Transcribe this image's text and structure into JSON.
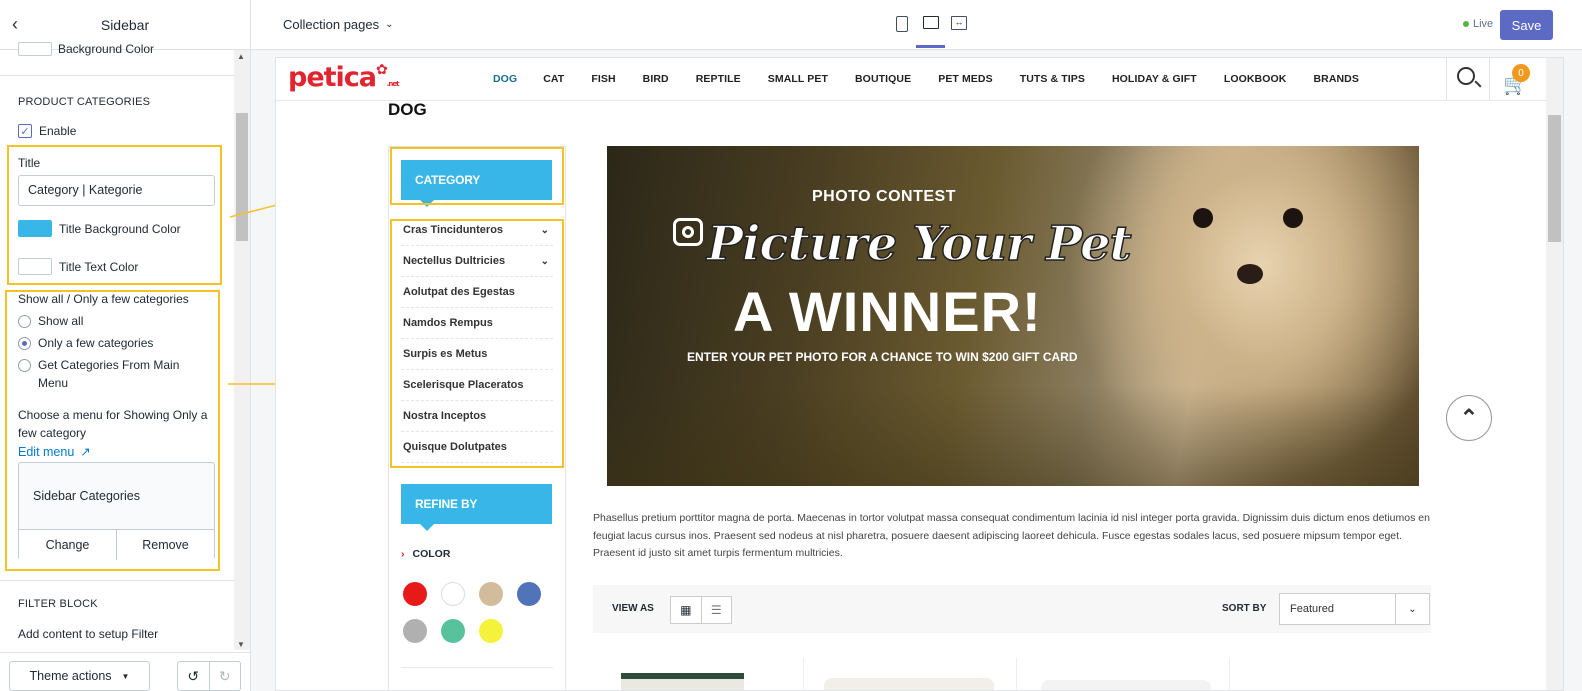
{
  "sidebar_panel": {
    "title": "Sidebar",
    "bg_color_label": "Background Color",
    "product_categories": {
      "heading": "PRODUCT CATEGORIES",
      "enable_label": "Enable",
      "enable_checked": true,
      "title_label": "Title",
      "title_value": "Category | Kategorie",
      "title_bg_label": "Title Background Color",
      "title_bg_color": "#38b6e8",
      "title_text_label": "Title Text Color",
      "title_text_color": "#ffffff",
      "show_label": "Show all / Only a few categories",
      "options": [
        "Show all",
        "Only a few categories",
        "Get Categories From Main Menu"
      ],
      "selected_option": "Only a few categories",
      "menu_label": "Choose a menu for Showing Only a few category",
      "edit_menu": "Edit menu",
      "menu_name": "Sidebar Categories",
      "change": "Change",
      "remove": "Remove"
    },
    "filter_block": {
      "heading": "FILTER BLOCK",
      "text": "Add content to setup Filter"
    },
    "theme_actions": "Theme actions"
  },
  "topbar": {
    "page_selector": "Collection pages",
    "live_label": "Live",
    "live_color": "#50b83c",
    "save": "Save",
    "accent": "#5c6ac4"
  },
  "store": {
    "logo": "petica",
    "logo_suffix": ".net",
    "nav": [
      "DOG",
      "CAT",
      "FISH",
      "BIRD",
      "REPTILE",
      "SMALL PET",
      "BOUTIQUE",
      "PET MEDS",
      "TUTS & TIPS",
      "HOLIDAY & GIFT",
      "LOOKBOOK",
      "BRANDS"
    ],
    "nav_active": "DOG",
    "cart_count": "0",
    "page_title": "DOG",
    "category_title": "CATEGORY",
    "categories": [
      "Cras Tincidunteros",
      "Nectellus Dultricies",
      "Aolutpat des Egestas",
      "Namdos Rempus",
      "Surpis es Metus",
      "Scelerisque Placeratos",
      "Nostra Inceptos",
      "Quisque Dolutpates"
    ],
    "categories_with_chevron": [
      "Cras Tincidunteros",
      "Nectellus Dultricies"
    ],
    "refine_title": "REFINE BY",
    "color_filter": "COLOR",
    "swatches": [
      "#e81919",
      "#ffffff",
      "#d2bc9c",
      "#5173b8",
      "#b0b0b0",
      "#57c29c",
      "#f5f23b"
    ],
    "banner": {
      "contest": "PHOTO CONTEST",
      "script": "Picture Your Pet",
      "winner": "A WINNER!",
      "subline": "ENTER YOUR PET PHOTO FOR A CHANCE TO WIN $200 GIFT CARD"
    },
    "description": "Phasellus pretium porttitor magna de porta. Maecenas in tortor volutpat massa consequat condimentum lacinia id nisl integer porta gravida. Dignissim duis dictum enos detiumos en feugiat lacus cursus inos. Praesent sed nodeus at nisl pharetra, posuere daesent adipiscing laoreet dehicula. Fusce egestas sodales lacus, sed posuere mipsum tempor eget. Praesent id justo sit amet turpis fermentum multricies.",
    "view_as": "VIEW AS",
    "sort_by": "SORT BY",
    "sort_value": "Featured"
  }
}
